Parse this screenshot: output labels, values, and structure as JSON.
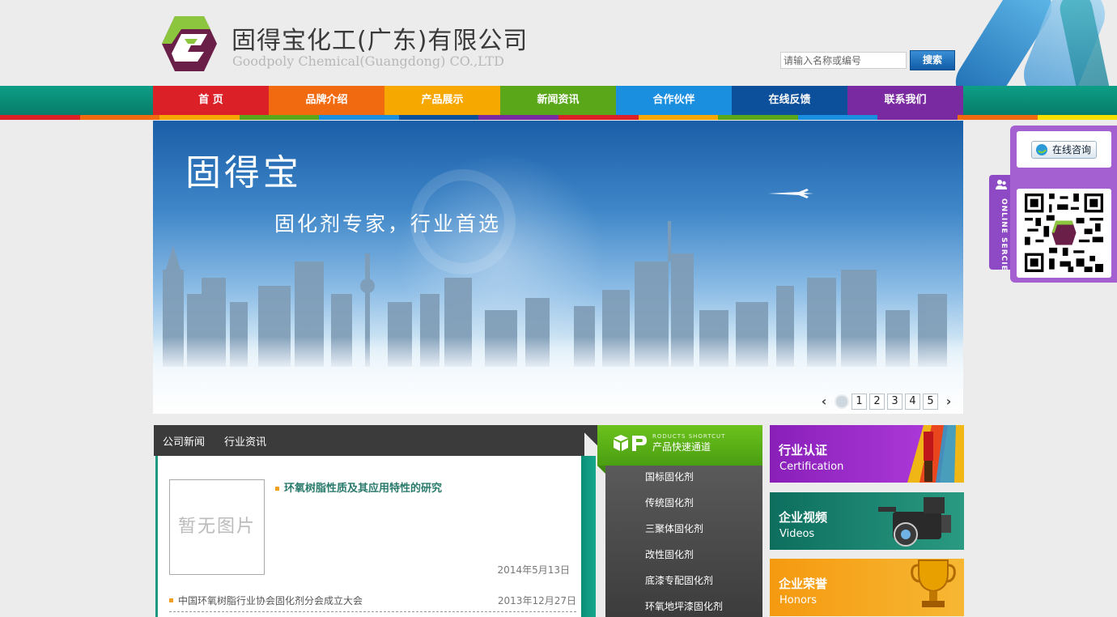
{
  "header": {
    "company_name": "固得宝化工(广东)有限公司",
    "company_name_en": "Goodpoly Chemical(Guangdong) CO.,LTD",
    "search_placeholder": "请输入名称或编号",
    "search_button": "搜索"
  },
  "nav": {
    "items": [
      {
        "label": "首 页",
        "color": "#dc2028"
      },
      {
        "label": "品牌介绍",
        "color": "#f26a10"
      },
      {
        "label": "产品展示",
        "color": "#f7a800"
      },
      {
        "label": "新闻资讯",
        "color": "#5aa81a"
      },
      {
        "label": "合作伙伴",
        "color": "#1a8fe0"
      },
      {
        "label": "在线反馈",
        "color": "#0c4f9a"
      },
      {
        "label": "联系我们",
        "color": "#7a2aa0"
      }
    ]
  },
  "banner": {
    "title": "固得宝",
    "slogan": "固化剂专家，行业首选",
    "pages": [
      "1",
      "2",
      "3",
      "4",
      "5"
    ]
  },
  "news": {
    "tabs": [
      "公司新闻",
      "行业资讯"
    ],
    "no_image": "暂无图片",
    "featured": {
      "title": "环氧树脂性质及其应用特性的研究",
      "date": "2014年5月13日"
    },
    "items": [
      {
        "title": "中国环氧树脂行业协会固化剂分会成立大会",
        "date": "2013年12月27日"
      }
    ]
  },
  "products": {
    "heading_en": "RODUCTS SHORTCUT",
    "heading_cn": "产品快速通道",
    "items": [
      "国标固化剂",
      "传统固化剂",
      "三聚体固化剂",
      "改性固化剂",
      "底漆专配固化剂",
      "环氧地坪漆固化剂"
    ]
  },
  "promos": [
    {
      "cn": "行业认证",
      "en": "Certification"
    },
    {
      "cn": "企业视频",
      "en": "Videos"
    },
    {
      "cn": "企业荣誉",
      "en": "Honors"
    }
  ],
  "service": {
    "tab_label": "ONLINE SERCIE",
    "consult_button": "在线咨询"
  },
  "colors": {
    "nav_band": "#0d9e86",
    "news_accent": "#1a9a82",
    "products_head": "#6cc21c",
    "service_panel": "#a45fd0"
  }
}
